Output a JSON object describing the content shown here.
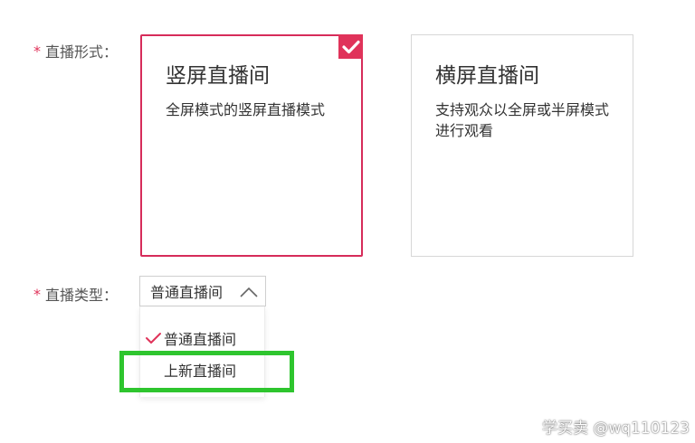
{
  "form": {
    "live_mode": {
      "required_mark": "*",
      "label": "直播形式："
    },
    "live_type": {
      "required_mark": "*",
      "label": "直播类型："
    }
  },
  "cards": {
    "vertical": {
      "title": "竖屏直播间",
      "description": "全屏模式的竖屏直播模式",
      "selected": true
    },
    "horizontal": {
      "title": "横屏直播间",
      "description": "支持观众以全屏或半屏模式进行观看",
      "selected": false
    }
  },
  "select": {
    "value": "普通直播间",
    "expanded": true,
    "options": [
      {
        "label": "普通直播间",
        "selected": true
      },
      {
        "label": "上新直播间",
        "selected": false
      }
    ]
  },
  "watermark": {
    "text": "学买卖 @wq110123"
  },
  "colors": {
    "accent": "#e0335a",
    "selected_border": "#d62c5a",
    "highlight": "#2ec52e",
    "border": "#d7d7d7"
  },
  "icons": {
    "card_check": "checkmark-icon",
    "select_toggle": "chevron-up-icon",
    "option_check": "checkmark-icon"
  }
}
